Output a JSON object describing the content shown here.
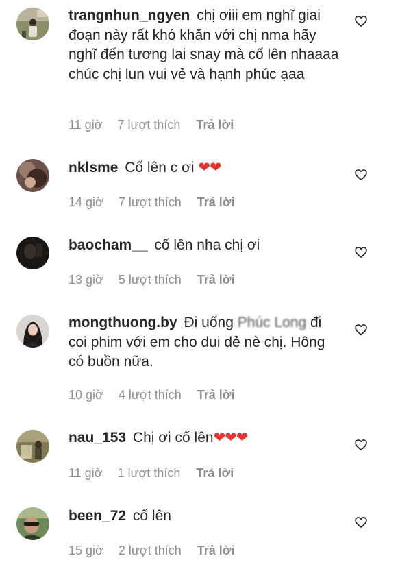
{
  "comments": [
    {
      "username": "trangnhun_ngyen",
      "text": "chị ơiii em nghĩ giai đoạn này rất khó khăn với chị nma hãy nghĩ đến tương lai snay mà cố lên nhaaaa chúc chị lun vui vẻ và hạnh phúc ạaa",
      "time": "11 giờ",
      "likes": "7 lượt thích",
      "reply": "Trả lời",
      "avatar_color": "#8a8f6a"
    },
    {
      "username": "nklsme",
      "text": "Cố lên c ơi",
      "emoji": "❤❤",
      "time": "14 giờ",
      "likes": "7 lượt thích",
      "reply": "Trả lời",
      "avatar_color": "#6b5248"
    },
    {
      "username": "baocham__",
      "text": "cố lên nha chị ơi",
      "time": "13 giờ",
      "likes": "5 lượt thích",
      "reply": "Trả lời",
      "avatar_color": "#1a1614"
    },
    {
      "username": "mongthuong.by",
      "text_before": "Đi uống",
      "text_blur": "Phúc Long",
      "text_after": "đi coi phim với em cho dui dẻ nè chị. Hông có buồn nữa.",
      "time": "10 giờ",
      "likes": "4 lượt thích",
      "reply": "Trả lời",
      "avatar_color": "#d9d6d2"
    },
    {
      "username": "nau_153",
      "text": "Chị ơi cố lên",
      "emoji": "❤❤❤",
      "time": "11 giờ",
      "likes": "1 lượt thích",
      "reply": "Trả lời",
      "avatar_color": "#7f7a52"
    },
    {
      "username": "been_72",
      "text": "cố lên",
      "time": "15 giờ",
      "likes": "2 lượt thích",
      "reply": "Trả lời",
      "avatar_color": "#6f8a5a"
    }
  ]
}
